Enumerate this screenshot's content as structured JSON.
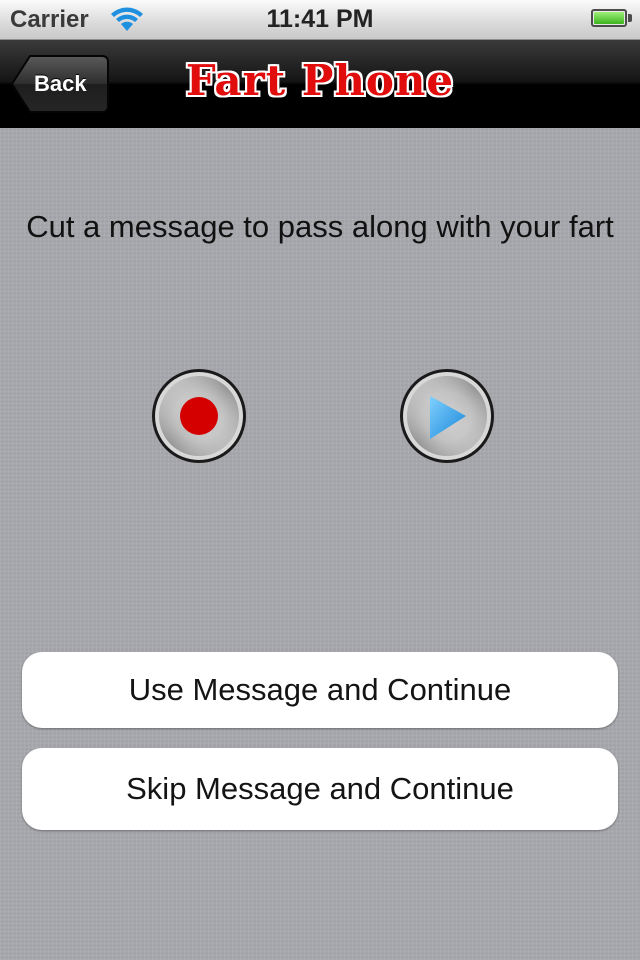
{
  "status_bar": {
    "carrier": "Carrier",
    "time": "11:41 PM",
    "battery_level": 1.0,
    "battery_color": "#3cb41c",
    "icons": [
      "wifi-icon",
      "battery-icon"
    ]
  },
  "nav_bar": {
    "back_label": "Back",
    "title": "Fart Phone",
    "title_color": "#e10c0c"
  },
  "main": {
    "prompt": "Cut a message to pass along with your fart",
    "controls": {
      "record_icon": "record-icon",
      "record_color": "#d40000",
      "play_icon": "play-icon",
      "play_color": "#3aa4ec"
    },
    "buttons": {
      "use_label": "Use Message and Continue",
      "skip_label": "Skip Message and Continue"
    }
  }
}
